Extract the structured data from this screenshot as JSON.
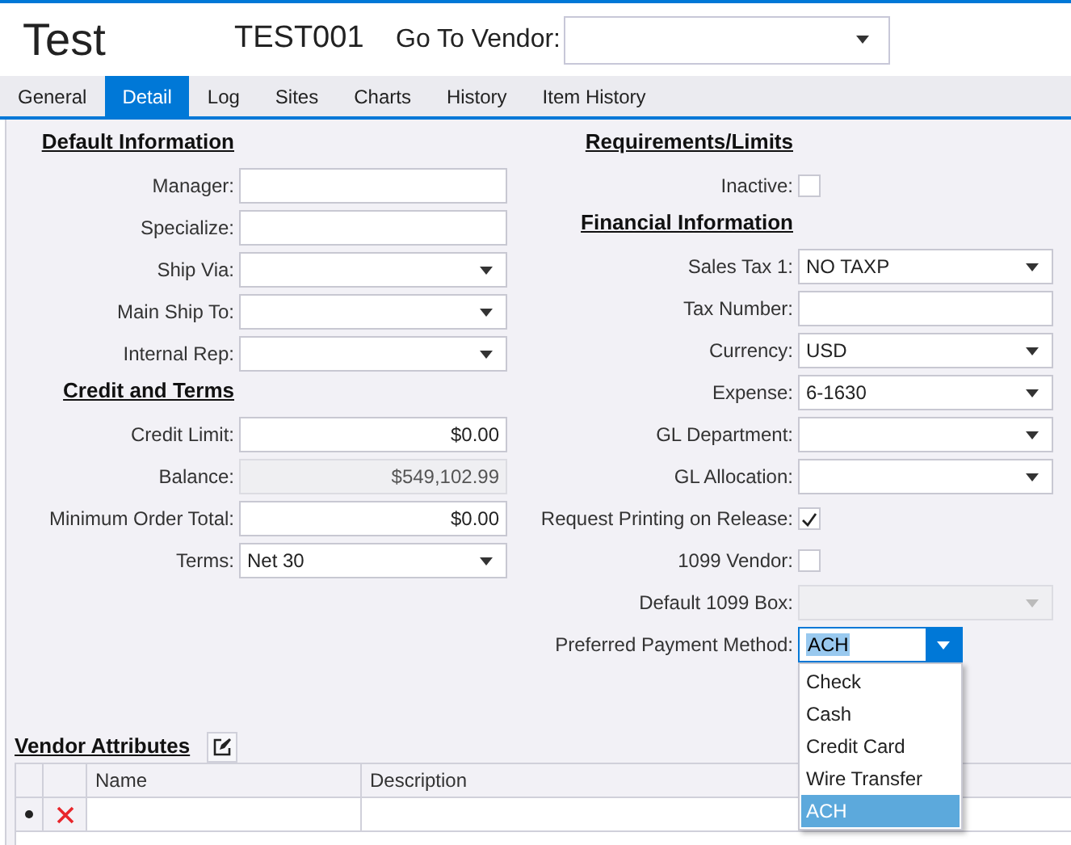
{
  "window": {
    "title": "Test",
    "code": "TEST001"
  },
  "go_to_vendor": {
    "label": "Go To Vendor:"
  },
  "tabs": [
    {
      "label": "General",
      "selected": false
    },
    {
      "label": "Detail",
      "selected": true
    },
    {
      "label": "Log",
      "selected": false
    },
    {
      "label": "Sites",
      "selected": false
    },
    {
      "label": "Charts",
      "selected": false
    },
    {
      "label": "History",
      "selected": false
    },
    {
      "label": "Item History",
      "selected": false
    }
  ],
  "left_sections": [
    {
      "heading": "Default Information",
      "fields": [
        {
          "label": "Manager:",
          "kind": "text"
        },
        {
          "label": "Specialize:",
          "kind": "text"
        },
        {
          "label": "Ship Via:",
          "kind": "dropdown"
        },
        {
          "label": "Main Ship To:",
          "kind": "dropdown"
        },
        {
          "label": "Internal Rep:",
          "kind": "dropdown"
        }
      ]
    },
    {
      "heading": "Credit and Terms",
      "fields": [
        {
          "label": "Credit Limit:",
          "kind": "amount",
          "value": "$0.00"
        },
        {
          "label": "Balance:",
          "kind": "amount",
          "value": "$549,102.99",
          "disabled": true
        },
        {
          "label": "Minimum Order Total:",
          "kind": "amount",
          "value": "$0.00"
        },
        {
          "label": "Terms:",
          "kind": "dropdown",
          "value": "Net 30"
        }
      ]
    }
  ],
  "right_sections": [
    {
      "heading": "Requirements/Limits",
      "fields": [
        {
          "label": "Inactive:",
          "kind": "checkbox",
          "checked": false
        }
      ]
    },
    {
      "heading": "Financial Information",
      "fields": [
        {
          "label": "Sales Tax 1:",
          "kind": "dropdown",
          "value": "NO TAXP"
        },
        {
          "label": "Tax Number:",
          "kind": "text"
        },
        {
          "label": "Currency:",
          "kind": "dropdown",
          "value": "USD"
        },
        {
          "label": "Expense:",
          "kind": "dropdown",
          "value": "6-1630"
        },
        {
          "label": "GL Department:",
          "kind": "dropdown"
        },
        {
          "label": "GL Allocation:",
          "kind": "dropdown"
        },
        {
          "label": "Request Printing on Release:",
          "kind": "checkbox",
          "checked": true
        },
        {
          "label": "1099 Vendor:",
          "kind": "checkbox",
          "checked": false
        },
        {
          "label": "Default 1099 Box:",
          "kind": "dropdown",
          "disabled": true
        },
        {
          "label": "Preferred Payment Method:",
          "kind": "open_dropdown",
          "value": "ACH",
          "expanded": true,
          "options": [
            {
              "label": "Check",
              "selected": false
            },
            {
              "label": "Cash",
              "selected": false
            },
            {
              "label": "Credit Card",
              "selected": false
            },
            {
              "label": "Wire Transfer",
              "selected": false
            },
            {
              "label": "ACH",
              "selected": true
            }
          ]
        }
      ]
    }
  ],
  "vendor_attributes": {
    "title": "Vendor Attributes",
    "columns": [
      "Name",
      "Description"
    ]
  }
}
